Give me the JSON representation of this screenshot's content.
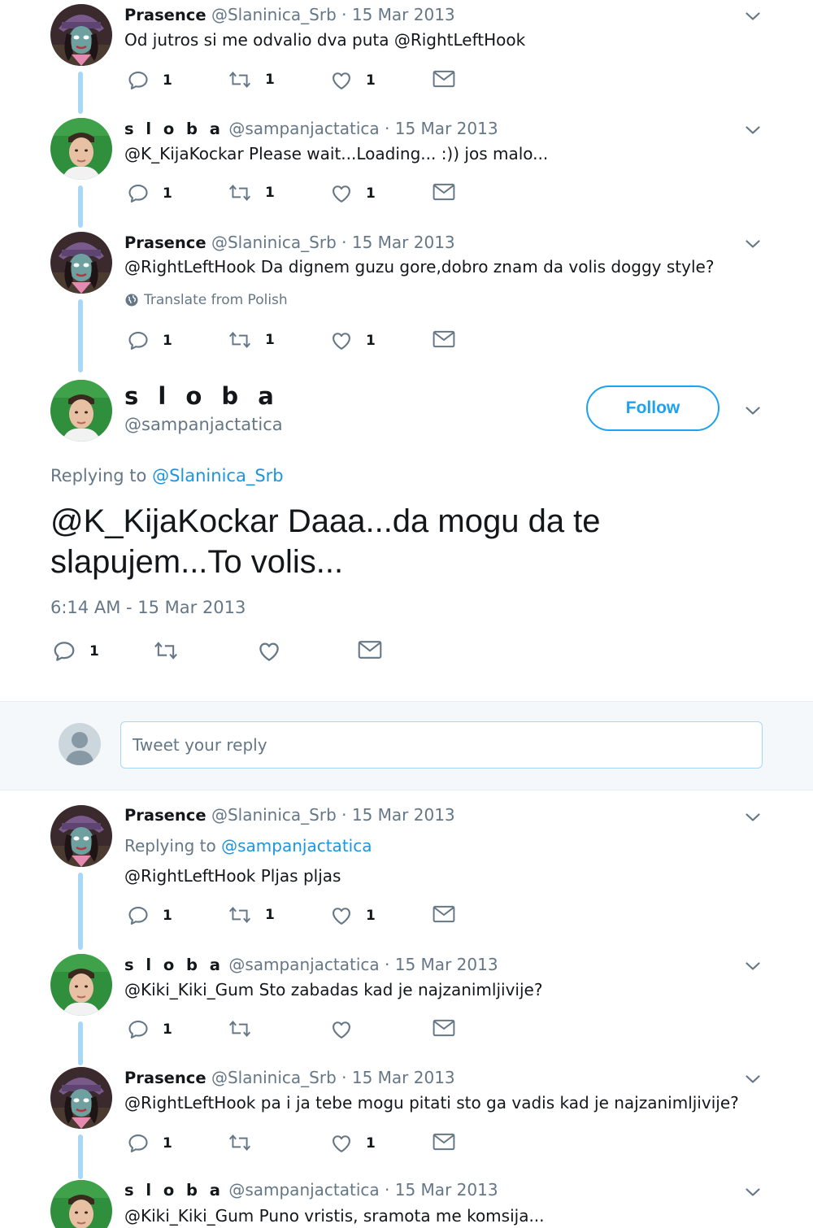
{
  "thread_top": [
    {
      "name": "Prasence",
      "handle": "@Slaninica_Srb",
      "date": "· 15 Mar 2013",
      "text": "Od jutros si me odvalio dva puta @RightLeftHook",
      "replies": "1",
      "retweets": "1",
      "likes": "1"
    },
    {
      "name": "s l o b a",
      "handle": "@sampanjactatica",
      "date": "· 15 Mar 2013",
      "text": "@K_KijaKockar Please wait...Loading... :)) jos malo...",
      "replies": "1",
      "retweets": "1",
      "likes": "1"
    },
    {
      "name": "Prasence",
      "handle": "@Slaninica_Srb",
      "date": "· 15 Mar 2013",
      "text": "@RightLeftHook  Da dignem guzu gore,dobro znam da volis doggy style?",
      "translate": "Translate from Polish",
      "replies": "1",
      "retweets": "1",
      "likes": "1"
    }
  ],
  "main_tweet": {
    "name": "s l o b a",
    "handle": "@sampanjactatica",
    "follow_label": "Follow",
    "replying_prefix": "Replying to",
    "replying_to": "@Slaninica_Srb",
    "text": "@K_KijaKockar Daaa...da mogu da te slapujem...To volis...",
    "timestamp": "6:14 AM - 15 Mar 2013",
    "replies": "1"
  },
  "reply_box": {
    "placeholder": "Tweet your reply"
  },
  "replies": [
    {
      "name": "Prasence",
      "handle": "@Slaninica_Srb",
      "date": "· 15 Mar 2013",
      "replying_prefix": "Replying to",
      "replying_to": "@sampanjactatica",
      "text": "@RightLeftHook Pljas pljas",
      "replies": "1",
      "retweets": "1",
      "likes": "1"
    },
    {
      "name": "s l o b a",
      "handle": "@sampanjactatica",
      "date": "· 15 Mar 2013",
      "text": "@Kiki_Kiki_Gum Sto zabadas kad je najzanimljivije?",
      "replies": "1"
    },
    {
      "name": "Prasence",
      "handle": "@Slaninica_Srb",
      "date": "· 15 Mar 2013",
      "text": "@RightLeftHook pa i ja tebe mogu pitati sto ga vadis kad je najzanimljivije?",
      "replies": "1",
      "likes": "1"
    },
    {
      "name": "s l o b a",
      "handle": "@sampanjactatica",
      "date": "· 15 Mar 2013",
      "text": "@Kiki_Kiki_Gum Puno vristis, sramota me komsija..."
    }
  ],
  "colors": {
    "accent": "#1da1f2",
    "link": "#1b95e0",
    "muted": "#657786",
    "thread_line": "#a9d7f6"
  },
  "icons": [
    "reply-icon",
    "retweet-icon",
    "like-icon",
    "direct-message-icon",
    "chevron-down-icon",
    "globe-icon"
  ]
}
